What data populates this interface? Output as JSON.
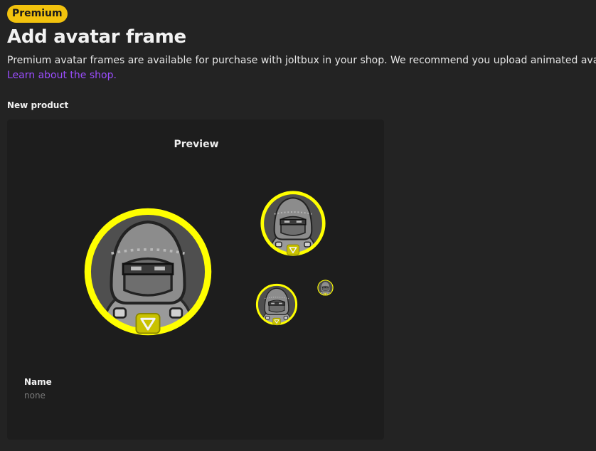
{
  "badge": {
    "label": "Premium"
  },
  "header": {
    "title": "Add avatar frame",
    "description": "Premium avatar frames are available for purchase with joltbux in your shop. We recommend you upload animated avatars.",
    "link_text": "Learn about the shop."
  },
  "section": {
    "label": "New product"
  },
  "preview": {
    "label": "Preview",
    "frame_color": "#ffff00"
  },
  "product": {
    "name_label": "Name",
    "name_value": "none"
  },
  "colors": {
    "badge_bg": "#f2c20d",
    "link": "#9b4dff",
    "frame": "#ffff00",
    "background": "#232323",
    "card": "#1d1d1d"
  },
  "icons": {
    "frame_emblem": "triangle-emblem-icon"
  }
}
